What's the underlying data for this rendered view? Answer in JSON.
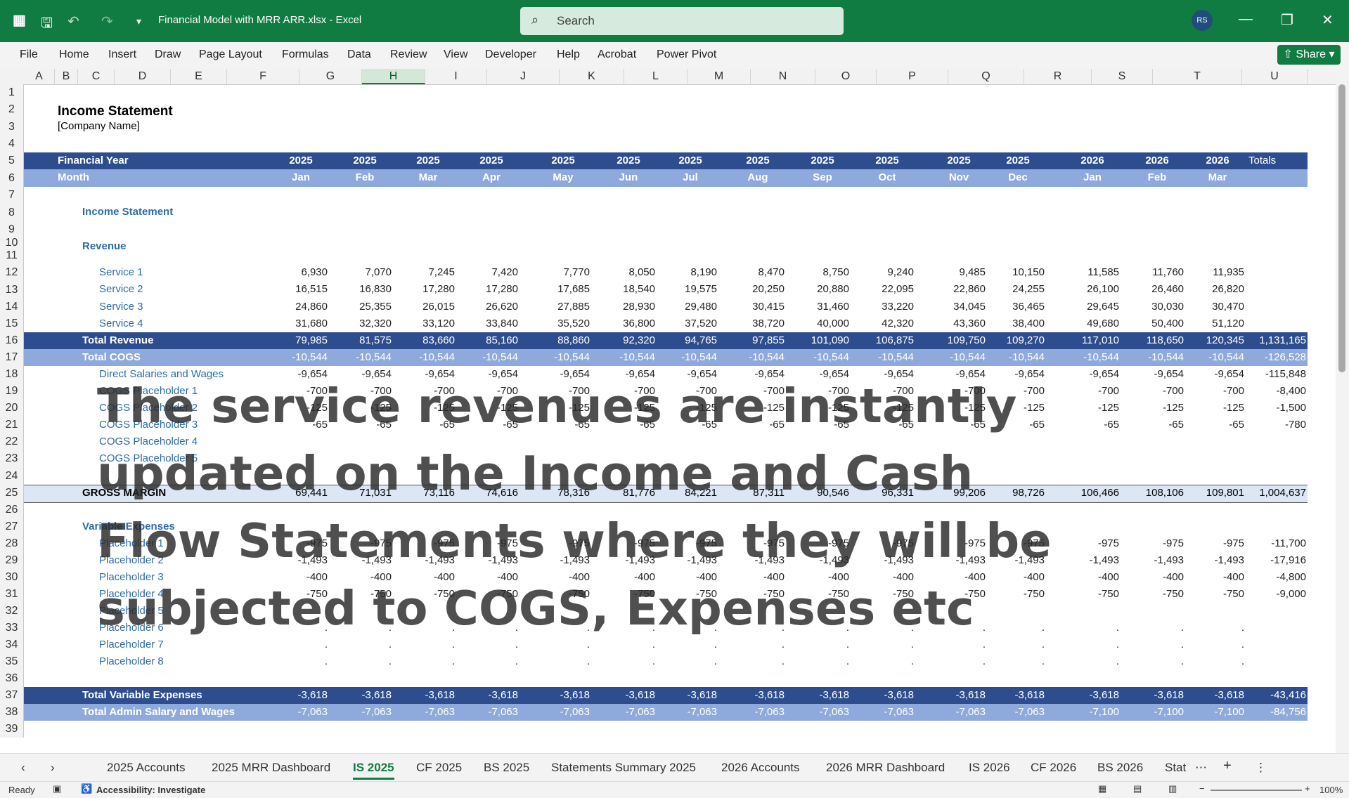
{
  "app": {
    "doc_title": "Financial Model with MRR ARR.xlsx  -  Excel",
    "search_placeholder": "Search",
    "avatar": "RS",
    "share": "Share"
  },
  "ribbon": [
    "File",
    "Home",
    "Insert",
    "Draw",
    "Page Layout",
    "Formulas",
    "Data",
    "Review",
    "View",
    "Developer",
    "Help",
    "Acrobat",
    "Power Pivot"
  ],
  "columns": [
    "A",
    "B",
    "C",
    "D",
    "E",
    "F",
    "G",
    "H",
    "I",
    "J",
    "K",
    "L",
    "M",
    "N",
    "O",
    "P",
    "Q",
    "R",
    "S",
    "T",
    "U"
  ],
  "selected_column": "H",
  "sheet": {
    "title": "Income Statement",
    "company": "[Company Name]",
    "fy_label": "Financial Year",
    "month_label": "Month",
    "years": [
      "2025",
      "2025",
      "2025",
      "2025",
      "2025",
      "2025",
      "2025",
      "2025",
      "2025",
      "2025",
      "2025",
      "2025",
      "2026",
      "2026",
      "2026"
    ],
    "months": [
      "Jan",
      "Feb",
      "Mar",
      "Apr",
      "May",
      "Jun",
      "Jul",
      "Aug",
      "Sep",
      "Oct",
      "Nov",
      "Dec",
      "Jan",
      "Feb",
      "Mar"
    ],
    "totals_label": "Totals",
    "section_income": "Income Statement",
    "section_revenue": "Revenue",
    "section_var": "Variable Expenses",
    "rows": [
      {
        "r": "12",
        "label": "Service 1",
        "style": "sub",
        "vals": [
          "6,930",
          "7,070",
          "7,245",
          "7,420",
          "7,770",
          "8,050",
          "8,190",
          "8,470",
          "8,750",
          "9,240",
          "9,485",
          "10,150",
          "11,585",
          "11,760",
          "11,935"
        ],
        "total": ""
      },
      {
        "r": "13",
        "label": "Service 2",
        "style": "sub",
        "vals": [
          "16,515",
          "16,830",
          "17,280",
          "17,280",
          "17,685",
          "18,540",
          "19,575",
          "20,250",
          "20,880",
          "22,095",
          "22,860",
          "24,255",
          "26,100",
          "26,460",
          "26,820"
        ],
        "total": ""
      },
      {
        "r": "14",
        "label": "Service 3",
        "style": "sub",
        "vals": [
          "24,860",
          "25,355",
          "26,015",
          "26,620",
          "27,885",
          "28,930",
          "29,480",
          "30,415",
          "31,460",
          "33,220",
          "34,045",
          "36,465",
          "29,645",
          "30,030",
          "30,470"
        ],
        "total": ""
      },
      {
        "r": "15",
        "label": "Service 4",
        "style": "sub",
        "vals": [
          "31,680",
          "32,320",
          "33,120",
          "33,840",
          "35,520",
          "36,800",
          "37,520",
          "38,720",
          "40,000",
          "42,320",
          "43,360",
          "38,400",
          "49,680",
          "50,400",
          "51,120"
        ],
        "total": ""
      },
      {
        "r": "16",
        "label": "Total Revenue",
        "style": "dark",
        "vals": [
          "79,985",
          "81,575",
          "83,660",
          "85,160",
          "88,860",
          "92,320",
          "94,765",
          "97,855",
          "101,090",
          "106,875",
          "109,750",
          "109,270",
          "117,010",
          "118,650",
          "120,345"
        ],
        "total": "1,131,165"
      },
      {
        "r": "17",
        "label": "Total COGS",
        "style": "light",
        "vals": [
          "-10,544",
          "-10,544",
          "-10,544",
          "-10,544",
          "-10,544",
          "-10,544",
          "-10,544",
          "-10,544",
          "-10,544",
          "-10,544",
          "-10,544",
          "-10,544",
          "-10,544",
          "-10,544",
          "-10,544"
        ],
        "total": "-126,528"
      },
      {
        "r": "18",
        "label": "Direct Salaries and Wages",
        "style": "sub",
        "vals": [
          "-9,654",
          "-9,654",
          "-9,654",
          "-9,654",
          "-9,654",
          "-9,654",
          "-9,654",
          "-9,654",
          "-9,654",
          "-9,654",
          "-9,654",
          "-9,654",
          "-9,654",
          "-9,654",
          "-9,654"
        ],
        "total": "-115,848"
      },
      {
        "r": "19",
        "label": "COGS Placeholder 1",
        "style": "sub",
        "vals": [
          "-700",
          "-700",
          "-700",
          "-700",
          "-700",
          "-700",
          "-700",
          "-700",
          "-700",
          "-700",
          "-700",
          "-700",
          "-700",
          "-700",
          "-700"
        ],
        "total": "-8,400"
      },
      {
        "r": "20",
        "label": "COGS Placeholder 2",
        "style": "sub",
        "vals": [
          "-125",
          "-125",
          "-125",
          "-125",
          "-125",
          "-125",
          "-125",
          "-125",
          "-125",
          "-125",
          "-125",
          "-125",
          "-125",
          "-125",
          "-125"
        ],
        "total": "-1,500"
      },
      {
        "r": "21",
        "label": "COGS Placeholder 3",
        "style": "sub",
        "vals": [
          "-65",
          "-65",
          "-65",
          "-65",
          "-65",
          "-65",
          "-65",
          "-65",
          "-65",
          "-65",
          "-65",
          "-65",
          "-65",
          "-65",
          "-65"
        ],
        "total": "-780"
      },
      {
        "r": "22",
        "label": "COGS Placeholder 4",
        "style": "sub",
        "vals": [],
        "total": ""
      },
      {
        "r": "23",
        "label": "COGS Placeholder 5",
        "style": "sub",
        "vals": [],
        "total": ""
      },
      {
        "r": "25",
        "label": "GROSS MARGIN",
        "style": "gm",
        "vals": [
          "69,441",
          "71,031",
          "73,116",
          "74,616",
          "78,316",
          "81,776",
          "84,221",
          "87,311",
          "90,546",
          "96,331",
          "99,206",
          "98,726",
          "106,466",
          "108,106",
          "109,801"
        ],
        "total": "1,004,637"
      },
      {
        "r": "28",
        "label": "Placeholder 1",
        "style": "sub",
        "vals": [
          "-975",
          "-975",
          "-975",
          "-975",
          "-975",
          "-975",
          "-975",
          "-975",
          "-975",
          "-975",
          "-975",
          "-975",
          "-975",
          "-975",
          "-975"
        ],
        "total": "-11,700"
      },
      {
        "r": "29",
        "label": "Placeholder 2",
        "style": "sub",
        "vals": [
          "-1,493",
          "-1,493",
          "-1,493",
          "-1,493",
          "-1,493",
          "-1,493",
          "-1,493",
          "-1,493",
          "-1,493",
          "-1,493",
          "-1,493",
          "-1,493",
          "-1,493",
          "-1,493",
          "-1,493"
        ],
        "total": "-17,916"
      },
      {
        "r": "30",
        "label": "Placeholder 3",
        "style": "sub",
        "vals": [
          "-400",
          "-400",
          "-400",
          "-400",
          "-400",
          "-400",
          "-400",
          "-400",
          "-400",
          "-400",
          "-400",
          "-400",
          "-400",
          "-400",
          "-400"
        ],
        "total": "-4,800"
      },
      {
        "r": "31",
        "label": "Placeholder 4",
        "style": "sub",
        "vals": [
          "-750",
          "-750",
          "-750",
          "-750",
          "-750",
          "-750",
          "-750",
          "-750",
          "-750",
          "-750",
          "-750",
          "-750",
          "-750",
          "-750",
          "-750"
        ],
        "total": "-9,000"
      },
      {
        "r": "32",
        "label": "Placeholder 5",
        "style": "sub",
        "vals": [],
        "total": ""
      },
      {
        "r": "33",
        "label": "Placeholder 6",
        "style": "sub",
        "vals": [
          ".",
          ".",
          ".",
          ".",
          ".",
          ".",
          ".",
          ".",
          ".",
          ".",
          ".",
          ".",
          ".",
          ".",
          "."
        ],
        "total": ""
      },
      {
        "r": "34",
        "label": "Placeholder 7",
        "style": "sub",
        "vals": [
          ".",
          ".",
          ".",
          ".",
          ".",
          ".",
          ".",
          ".",
          ".",
          ".",
          ".",
          ".",
          ".",
          ".",
          "."
        ],
        "total": ""
      },
      {
        "r": "35",
        "label": "Placeholder 8",
        "style": "sub",
        "vals": [
          ".",
          ".",
          ".",
          ".",
          ".",
          ".",
          ".",
          ".",
          ".",
          ".",
          ".",
          ".",
          ".",
          ".",
          "."
        ],
        "total": ""
      },
      {
        "r": "37",
        "label": "Total Variable Expenses",
        "style": "dark",
        "vals": [
          "-3,618",
          "-3,618",
          "-3,618",
          "-3,618",
          "-3,618",
          "-3,618",
          "-3,618",
          "-3,618",
          "-3,618",
          "-3,618",
          "-3,618",
          "-3,618",
          "-3,618",
          "-3,618",
          "-3,618"
        ],
        "total": "-43,416"
      },
      {
        "r": "38",
        "label": "Total Admin Salary and Wages",
        "style": "light",
        "vals": [
          "-7,063",
          "-7,063",
          "-7,063",
          "-7,063",
          "-7,063",
          "-7,063",
          "-7,063",
          "-7,063",
          "-7,063",
          "-7,063",
          "-7,063",
          "-7,063",
          "-7,100",
          "-7,100",
          "-7,100"
        ],
        "total": "-84,756"
      }
    ]
  },
  "overlay_text": "The service revenues are instantly updated on the Income and Cash Flow Statements where they will be subjected to COGS, Expenses etc",
  "sheet_tabs": [
    "2025 Accounts",
    "2025 MRR Dashboard",
    "IS 2025",
    "CF 2025",
    "BS 2025",
    "Statements Summary 2025",
    "2026 Accounts",
    "2026 MRR Dashboard",
    "IS 2026",
    "CF 2026",
    "BS 2026",
    "Stat"
  ],
  "active_tab": "IS 2025",
  "status": {
    "ready": "Ready",
    "accessibility": "Accessibility: Investigate",
    "zoom": "100%"
  }
}
